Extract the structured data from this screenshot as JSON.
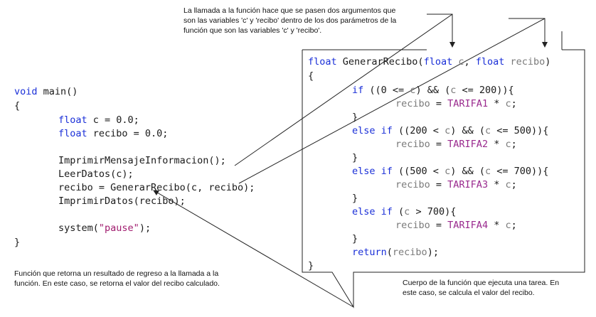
{
  "annotations": {
    "top_note": [
      "La llamada a la función hace que se pasen dos argumentos que",
      "son las variables 'c' y 'recibo' dentro de los dos parámetros de la",
      "función que son las variables 'c' y 'recibo'."
    ],
    "bottom_left_note": [
      "Función que retorna un resultado de regreso a la llamada a la",
      "función. En este caso, se retorna el valor del recibo calculado."
    ],
    "bottom_right_note": [
      "Cuerpo de la función que ejecuta una tarea. En",
      "este caso, se calcula el valor del recibo."
    ]
  },
  "main_code": {
    "line1_kw": "void",
    "line1_rest": " main()",
    "open_brace": "{",
    "line_float1_kw": "float",
    "line_float1_rest": " c = 0.0;",
    "line_float2_kw": "float",
    "line_float2_rest": " recibo = 0.0;",
    "call1": "ImprimirMensajeInformacion();",
    "call2": "LeerDatos(c);",
    "call3": "recibo = GenerarRecibo(c, recibo);",
    "call4": "ImprimirDatos(recibo);",
    "sys_a": "system(",
    "sys_str": "\"pause\"",
    "sys_b": ");",
    "close_brace": "}"
  },
  "func_code": {
    "sig_kw1": "float",
    "sig_name": " GenerarRecibo(",
    "sig_kw2": "float",
    "sig_p1": " c",
    "sig_comma": ", ",
    "sig_kw3": "float",
    "sig_p2": " recibo",
    "sig_close": ")",
    "open_brace": "{",
    "if1_kw": "if",
    "if1_a": " ((0 <= ",
    "if1_c1": "c",
    "if1_b": ") && (",
    "if1_c2": "c",
    "if1_end": " <= 200)){",
    "as1_var": "recibo",
    "as1_eq": " = ",
    "as1_const": "TARIFA1",
    "as1_end": " * ",
    "as1_c": "c",
    "as1_semi": ";",
    "close1": "}",
    "if2_kw": "else if",
    "if2_a": " ((200 < ",
    "if2_c1": "c",
    "if2_b": ") && (",
    "if2_c2": "c",
    "if2_end": " <= 500)){",
    "as2_const": "TARIFA2",
    "close2": "}",
    "if3_kw": "else if",
    "if3_a": " ((500 < ",
    "if3_c1": "c",
    "if3_b": ") && (",
    "if3_c2": "c",
    "if3_end": " <= 700)){",
    "as3_const": "TARIFA3",
    "close3": "}",
    "if4_kw": "else if",
    "if4_a": " (",
    "if4_c1": "c",
    "if4_end": " > 700){",
    "as4_const": "TARIFA4",
    "close4": "}",
    "ret_kw": "return",
    "ret_a": "(",
    "ret_var": "recibo",
    "ret_b": ");",
    "close_brace": "}"
  }
}
